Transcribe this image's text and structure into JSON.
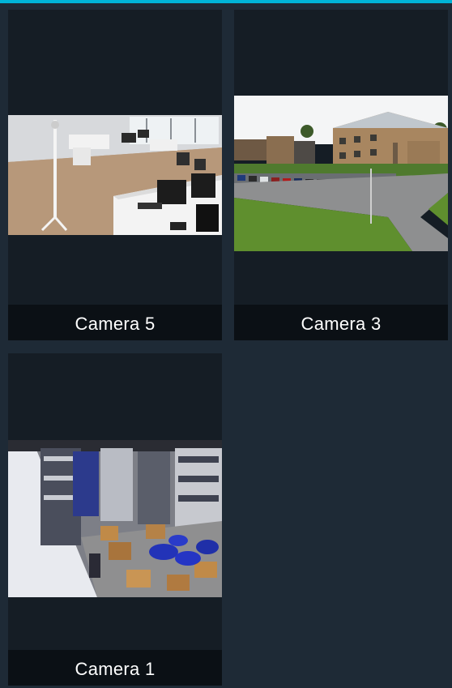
{
  "colors": {
    "background": "#1e2a36",
    "tile": "#151d25",
    "caption_bar": "#0b1015",
    "accent": "#00b4d8",
    "caption_text": "#ffffff"
  },
  "cameras": [
    {
      "label": "Camera 5",
      "scene": "office-interior"
    },
    {
      "label": "Camera 3",
      "scene": "parking-lot-exterior"
    },
    {
      "label": "Camera 1",
      "scene": "warehouse-interior"
    }
  ]
}
